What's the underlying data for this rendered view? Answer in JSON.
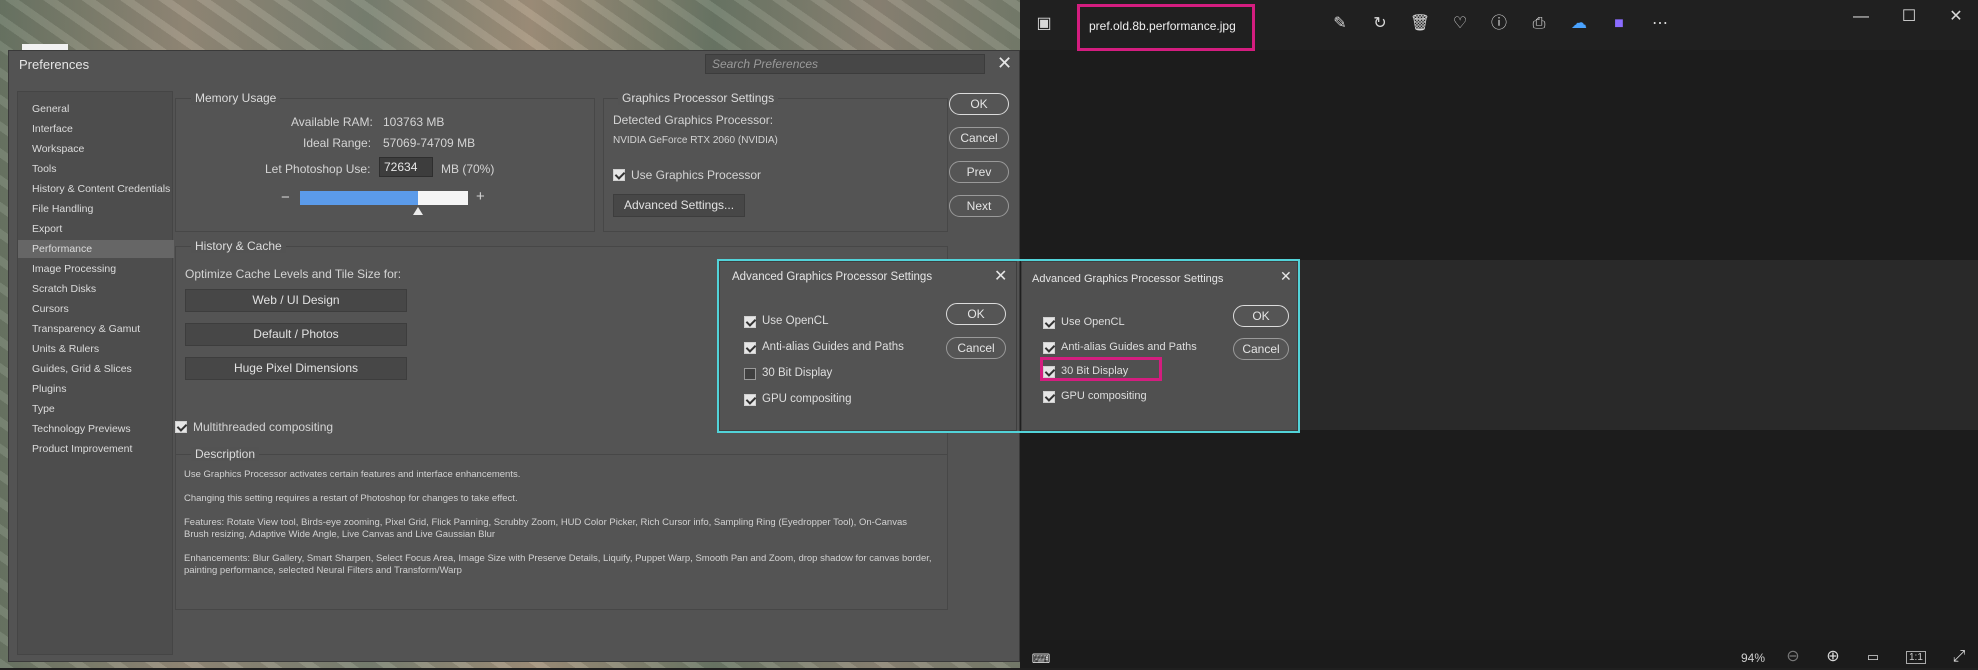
{
  "viewer": {
    "file_name": "pref.old.8b.performance.jpg",
    "zoom": "94%",
    "fit_label": "1:1",
    "toolbar_icons": [
      "edit-image-icon",
      "rotate-icon",
      "delete-icon",
      "favorite-icon",
      "info-icon",
      "print-icon",
      "onedrive-icon",
      "clipchamp-icon",
      "more-icon"
    ],
    "window_controls": [
      "minimize-icon",
      "maximize-icon",
      "close-icon"
    ]
  },
  "prefs": {
    "title": "Preferences",
    "search_placeholder": "Search Preferences",
    "sidebar": [
      "General",
      "Interface",
      "Workspace",
      "Tools",
      "History & Content Credentials",
      "File Handling",
      "Export",
      "Performance",
      "Image Processing",
      "Scratch Disks",
      "Cursors",
      "Transparency & Gamut",
      "Units & Rulers",
      "Guides, Grid & Slices",
      "Plugins",
      "Type",
      "Technology Previews",
      "Product Improvement"
    ],
    "selected_index": 7,
    "buttons": {
      "ok": "OK",
      "cancel": "Cancel",
      "prev": "Prev",
      "next": "Next"
    },
    "memory": {
      "title": "Memory Usage",
      "available_label": "Available RAM:",
      "available_value": "103763 MB",
      "ideal_label": "Ideal Range:",
      "ideal_value": "57069-74709 MB",
      "let_label": "Let Photoshop Use:",
      "let_value": "72634",
      "let_unit": "MB (70%)",
      "minus": "−",
      "plus": "+",
      "slider_fraction": 0.7
    },
    "gpu": {
      "title": "Graphics Processor Settings",
      "detected_label": "Detected Graphics Processor:",
      "detected_value": "NVIDIA GeForce RTX 2060 (NVIDIA)",
      "use_gpu_label": "Use Graphics Processor",
      "use_gpu_checked": true,
      "advanced_button": "Advanced Settings..."
    },
    "history": {
      "title": "History & Cache",
      "optimize_label": "Optimize Cache Levels and Tile Size for:",
      "buttons": [
        "Web / UI Design",
        "Default / Photos",
        "Huge Pixel Dimensions"
      ]
    },
    "multithreaded_label": "Multithreaded compositing",
    "multithreaded_checked": true,
    "description": {
      "title": "Description",
      "lines": [
        "Use Graphics Processor activates certain features and interface enhancements.",
        "Changing this setting requires a restart of Photoshop for changes to take effect.",
        "Features: Rotate View tool, Birds-eye zooming, Pixel Grid, Flick Panning, Scrubby Zoom, HUD Color Picker, Rich Cursor info, Sampling Ring (Eyedropper Tool), On-Canvas Brush resizing, Adaptive Wide Angle, Live Canvas and Live Gaussian Blur",
        "Enhancements: Blur Gallery, Smart Sharpen, Select Focus Area, Image Size with Preserve Details, Liquify, Puppet Warp, Smooth Pan and Zoom, drop shadow for canvas border, painting performance, selected Neural Filters and Transform/Warp"
      ]
    }
  },
  "advanced_left": {
    "title": "Advanced Graphics Processor Settings",
    "ok": "OK",
    "cancel": "Cancel",
    "options": [
      {
        "label": "Use OpenCL",
        "checked": true
      },
      {
        "label": "Anti-alias Guides and Paths",
        "checked": true
      },
      {
        "label": "30 Bit Display",
        "checked": false
      },
      {
        "label": "GPU compositing",
        "checked": true
      }
    ]
  },
  "advanced_right": {
    "title": "Advanced Graphics Processor Settings",
    "ok": "OK",
    "cancel": "Cancel",
    "options": [
      {
        "label": "Use OpenCL",
        "checked": true
      },
      {
        "label": "Anti-alias Guides and Paths",
        "checked": true
      },
      {
        "label": "30 Bit Display",
        "checked": true
      },
      {
        "label": "GPU compositing",
        "checked": true
      }
    ]
  },
  "colors": {
    "highlight_cyan": "#52d3d9",
    "highlight_pink": "#d41d7f",
    "slider_fill": "#5b9bea"
  }
}
